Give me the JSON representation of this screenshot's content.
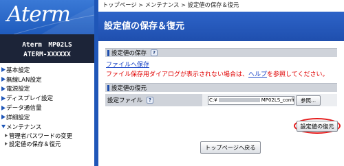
{
  "sidebar": {
    "logo": "Aterm",
    "model_line1": "Aterm　MP02LS",
    "model_line2": "ATERM-XXXXXX",
    "items": [
      {
        "label": "基本設定"
      },
      {
        "label": "無線LAN設定"
      },
      {
        "label": "電源設定"
      },
      {
        "label": "ディスプレイ設定"
      },
      {
        "label": "データ通信量"
      },
      {
        "label": "詳細設定"
      },
      {
        "label": "メンテナンス"
      }
    ],
    "sub_items": [
      {
        "label": "管理者パスワードの変更"
      },
      {
        "label": "設定値の保存＆復元"
      }
    ]
  },
  "breadcrumb": "トップページ > メンテナンス > 設定値の保存＆復元",
  "page_title": "設定値の保存＆復元",
  "save_section": {
    "title": "設定値の保存",
    "help": "?",
    "link": "ファイルへ保存",
    "message_before": "ファイル保存用ダイアログが表示されない場合は、",
    "message_link": "ヘルプ",
    "message_after": "を参照してください。"
  },
  "restore_section": {
    "title": "設定値の復元",
    "file_label": "設定ファイル",
    "help": "?",
    "file_value_start": "C:¥",
    "file_value_end": "MP02LS_config.b",
    "browse_label": "参照...",
    "restore_button": "設定値の復元"
  },
  "top_button": "トップページへ戻る",
  "colors": {
    "accent_blue": "#1f56b8",
    "highlight_red": "#e51a1a",
    "warning_text": "#e00000"
  }
}
